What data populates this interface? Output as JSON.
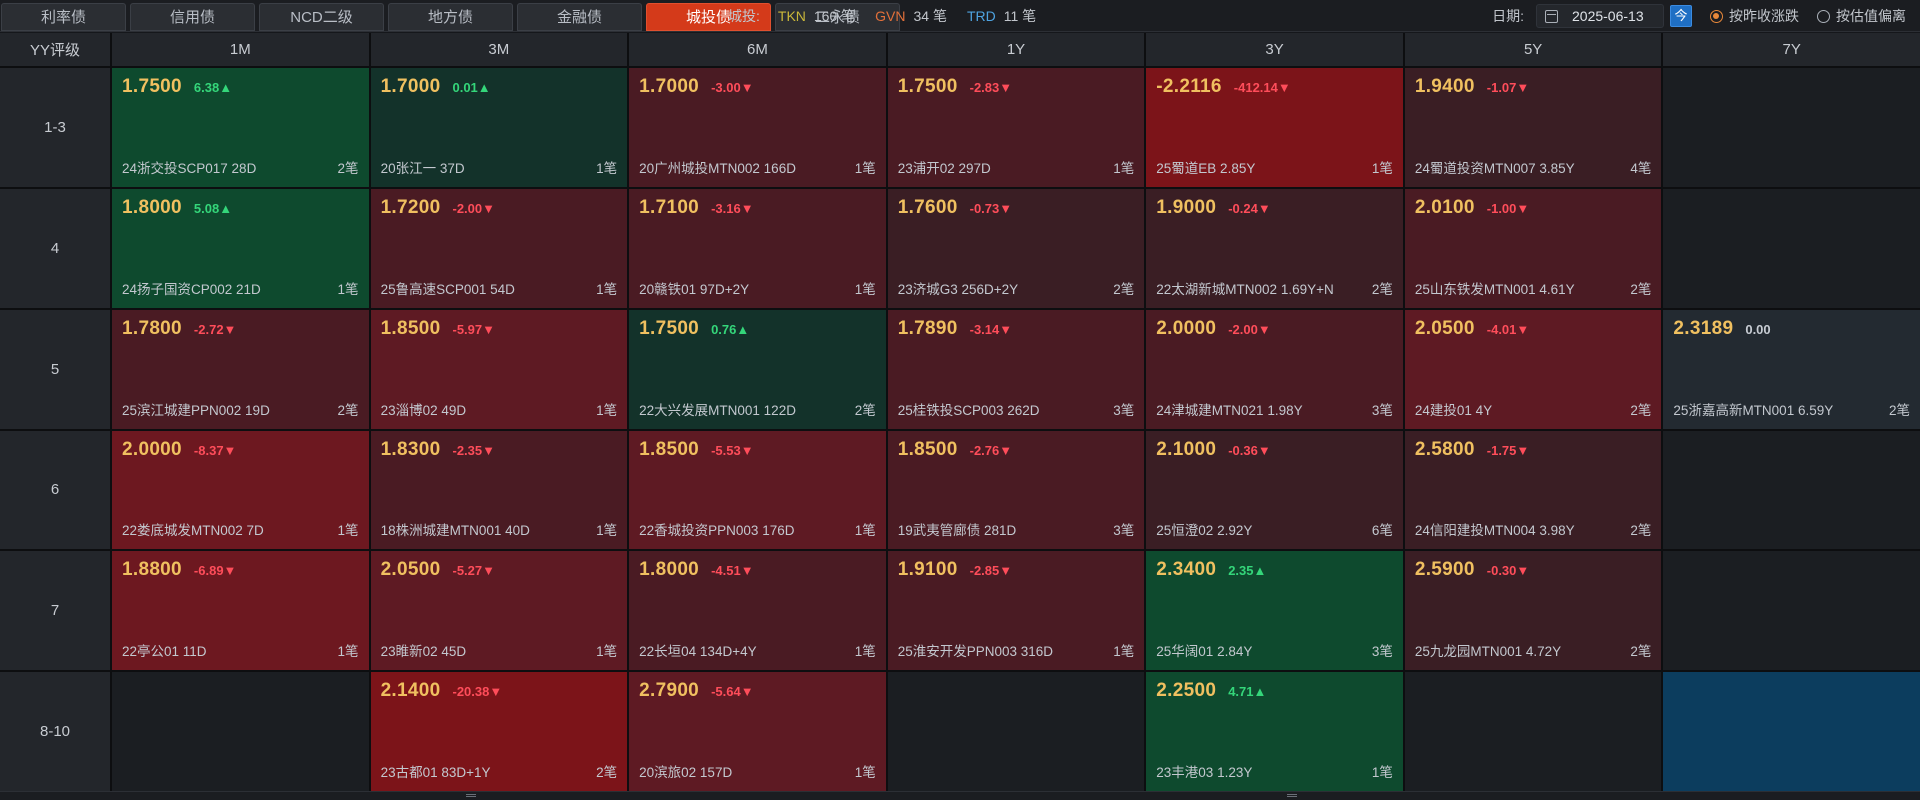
{
  "tabs": [
    {
      "label": "利率债",
      "active": false
    },
    {
      "label": "信用债",
      "active": false
    },
    {
      "label": "NCD二级",
      "active": false
    },
    {
      "label": "地方债",
      "active": false
    },
    {
      "label": "金融债",
      "active": false
    },
    {
      "label": "城投债",
      "active": true
    },
    {
      "label": "二永债",
      "active": false
    }
  ],
  "stats": {
    "label": "城投:",
    "tkn": {
      "tag": "TKN",
      "count": "160 笔",
      "color": "#c9b73a"
    },
    "gvn": {
      "tag": "GVN",
      "count": "34 笔",
      "color": "#e2703a"
    },
    "trd": {
      "tag": "TRD",
      "count": "11 笔",
      "color": "#4ea3e0"
    }
  },
  "date": {
    "label": "日期:",
    "value": "2025-06-13",
    "today_button": "今"
  },
  "options": [
    {
      "label": "按昨收涨跌",
      "selected": true
    },
    {
      "label": "按估值偏离",
      "selected": false
    }
  ],
  "grid": {
    "corner_label": "YY评级",
    "columns": [
      "1M",
      "3M",
      "6M",
      "1Y",
      "3Y",
      "5Y",
      "7Y"
    ],
    "rows": [
      {
        "label": "1-3",
        "cells": [
          {
            "rate": "1.7500",
            "change": "6.38▲",
            "dir": "up",
            "tone": "c-green",
            "bond": "24浙交投SCP017 28D",
            "trades": "2笔"
          },
          {
            "rate": "1.7000",
            "change": "0.01▲",
            "dir": "up",
            "tone": "c-dgreen",
            "bond": "20张江一 37D",
            "trades": "1笔"
          },
          {
            "rate": "1.7000",
            "change": "-3.00▼",
            "dir": "dn",
            "tone": "c-red2",
            "bond": "20广州城投MTN002 166D",
            "trades": "1笔"
          },
          {
            "rate": "1.7500",
            "change": "-2.83▼",
            "dir": "dn",
            "tone": "c-red2",
            "bond": "23浦开02 297D",
            "trades": "1笔"
          },
          {
            "rate": "-2.2116",
            "change": "-412.14▼",
            "dir": "dn",
            "tone": "c-red5",
            "bond": "25蜀道EB 2.85Y",
            "trades": "1笔"
          },
          {
            "rate": "1.9400",
            "change": "-1.07▼",
            "dir": "dn",
            "tone": "c-red1",
            "bond": "24蜀道投资MTN007 3.85Y",
            "trades": "4笔"
          },
          null
        ]
      },
      {
        "label": "4",
        "cells": [
          {
            "rate": "1.8000",
            "change": "5.08▲",
            "dir": "up",
            "tone": "c-green",
            "bond": "24扬子国资CP002 21D",
            "trades": "1笔"
          },
          {
            "rate": "1.7200",
            "change": "-2.00▼",
            "dir": "dn",
            "tone": "c-red2",
            "bond": "25鲁高速SCP001 54D",
            "trades": "1笔"
          },
          {
            "rate": "1.7100",
            "change": "-3.16▼",
            "dir": "dn",
            "tone": "c-red2",
            "bond": "20赣铁01 97D+2Y",
            "trades": "1笔"
          },
          {
            "rate": "1.7600",
            "change": "-0.73▼",
            "dir": "dn",
            "tone": "c-red1",
            "bond": "23济城G3 256D+2Y",
            "trades": "2笔"
          },
          {
            "rate": "1.9000",
            "change": "-0.24▼",
            "dir": "dn",
            "tone": "c-red1",
            "bond": "22太湖新城MTN002 1.69Y+N",
            "trades": "2笔"
          },
          {
            "rate": "2.0100",
            "change": "-1.00▼",
            "dir": "dn",
            "tone": "c-red2",
            "bond": "25山东铁发MTN001 4.61Y",
            "trades": "2笔"
          },
          null
        ]
      },
      {
        "label": "5",
        "cells": [
          {
            "rate": "1.7800",
            "change": "-2.72▼",
            "dir": "dn",
            "tone": "c-red2",
            "bond": "25滨江城建PPN002 19D",
            "trades": "2笔"
          },
          {
            "rate": "1.8500",
            "change": "-5.97▼",
            "dir": "dn",
            "tone": "c-red3",
            "bond": "23淄博02 49D",
            "trades": "1笔"
          },
          {
            "rate": "1.7500",
            "change": "0.76▲",
            "dir": "up",
            "tone": "c-dgreen",
            "bond": "22大兴发展MTN001 122D",
            "trades": "2笔"
          },
          {
            "rate": "1.7890",
            "change": "-3.14▼",
            "dir": "dn",
            "tone": "c-red2",
            "bond": "25桂铁投SCP003 262D",
            "trades": "3笔"
          },
          {
            "rate": "2.0000",
            "change": "-2.00▼",
            "dir": "dn",
            "tone": "c-red2",
            "bond": "24津城建MTN021 1.98Y",
            "trades": "3笔"
          },
          {
            "rate": "2.0500",
            "change": "-4.01▼",
            "dir": "dn",
            "tone": "c-red3",
            "bond": "24建投01 4Y",
            "trades": "2笔"
          },
          {
            "rate": "2.3189",
            "change": "0.00",
            "dir": "flat",
            "tone": "c-neutral",
            "bond": "25浙嘉高新MTN001 6.59Y",
            "trades": "2笔"
          }
        ]
      },
      {
        "label": "6",
        "cells": [
          {
            "rate": "2.0000",
            "change": "-8.37▼",
            "dir": "dn",
            "tone": "c-red4",
            "bond": "22娄底城发MTN002 7D",
            "trades": "1笔"
          },
          {
            "rate": "1.8300",
            "change": "-2.35▼",
            "dir": "dn",
            "tone": "c-red2",
            "bond": "18株洲城建MTN001 40D",
            "trades": "1笔"
          },
          {
            "rate": "1.8500",
            "change": "-5.53▼",
            "dir": "dn",
            "tone": "c-red3",
            "bond": "22香城投资PPN003 176D",
            "trades": "1笔"
          },
          {
            "rate": "1.8500",
            "change": "-2.76▼",
            "dir": "dn",
            "tone": "c-red2",
            "bond": "19武夷管廊债 281D",
            "trades": "3笔"
          },
          {
            "rate": "2.1000",
            "change": "-0.36▼",
            "dir": "dn",
            "tone": "c-red1",
            "bond": "25恒澄02 2.92Y",
            "trades": "6笔"
          },
          {
            "rate": "2.5800",
            "change": "-1.75▼",
            "dir": "dn",
            "tone": "c-red1",
            "bond": "24信阳建投MTN004 3.98Y",
            "trades": "2笔"
          },
          null
        ]
      },
      {
        "label": "7",
        "cells": [
          {
            "rate": "1.8800",
            "change": "-6.89▼",
            "dir": "dn",
            "tone": "c-red4",
            "bond": "22亭公01 11D",
            "trades": "1笔"
          },
          {
            "rate": "2.0500",
            "change": "-5.27▼",
            "dir": "dn",
            "tone": "c-red3",
            "bond": "23睢新02 45D",
            "trades": "1笔"
          },
          {
            "rate": "1.8000",
            "change": "-4.51▼",
            "dir": "dn",
            "tone": "c-red2",
            "bond": "22长垣04 134D+4Y",
            "trades": "1笔"
          },
          {
            "rate": "1.9100",
            "change": "-2.85▼",
            "dir": "dn",
            "tone": "c-red2",
            "bond": "25淮安开发PPN003 316D",
            "trades": "1笔"
          },
          {
            "rate": "2.3400",
            "change": "2.35▲",
            "dir": "up",
            "tone": "c-green",
            "bond": "25华阔01 2.84Y",
            "trades": "3笔"
          },
          {
            "rate": "2.5900",
            "change": "-0.30▼",
            "dir": "dn",
            "tone": "c-red1",
            "bond": "25九龙园MTN001 4.72Y",
            "trades": "2笔"
          },
          null
        ]
      },
      {
        "label": "8-10",
        "cells": [
          null,
          {
            "rate": "2.1400",
            "change": "-20.38▼",
            "dir": "dn",
            "tone": "c-red5",
            "bond": "23古都01 83D+1Y",
            "trades": "2笔"
          },
          {
            "rate": "2.7900",
            "change": "-5.64▼",
            "dir": "dn",
            "tone": "c-red3",
            "bond": "20滨旅02 157D",
            "trades": "1笔"
          },
          null,
          {
            "rate": "2.2500",
            "change": "4.71▲",
            "dir": "up",
            "tone": "c-green",
            "bond": "23丰港03 1.23Y",
            "trades": "1笔"
          },
          null,
          "selected"
        ]
      }
    ]
  }
}
